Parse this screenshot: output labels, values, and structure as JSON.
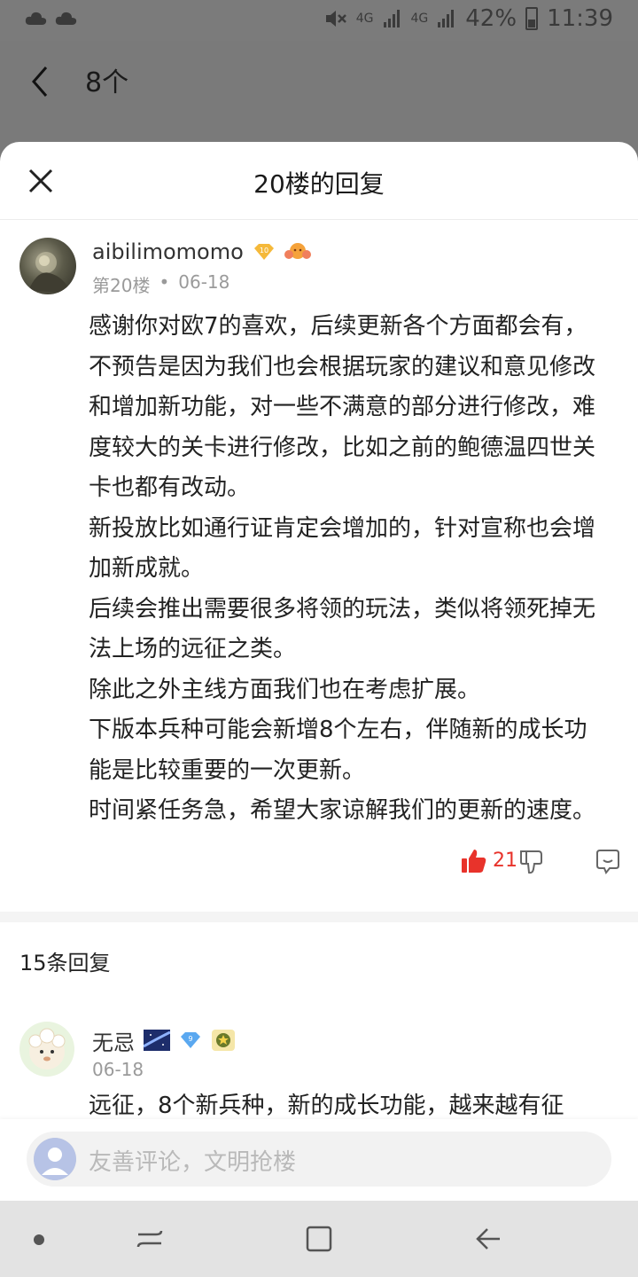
{
  "status_bar": {
    "battery": "42%",
    "time": "11:39",
    "net1": "4G",
    "net2": "4G"
  },
  "page": {
    "count_title": "8个"
  },
  "sheet": {
    "title": "20楼的回复"
  },
  "post": {
    "username": "aibilimomomo",
    "level": "10",
    "floor": "第20楼",
    "separator": "•",
    "date": "06-18",
    "paragraphs": [
      "感谢你对欧7的喜欢，后续更新各个方面都会有，不预告是因为我们也会根据玩家的建议和意见修改和增加新功能，对一些不满意的部分进行修改，难度较大的关卡进行修改，比如之前的鲍德温四世关卡也都有改动。",
      "新投放比如通行证肯定会增加的，针对宣称也会增加新成就。",
      "后续会推出需要很多将领的玩法，类似将领死掉无法上场的远征之类。",
      "除此之外主线方面我们也在考虑扩展。",
      "下版本兵种可能会新增8个左右，伴随新的成长功能是比较重要的一次更新。",
      "时间紧任务急，希望大家谅解我们的更新的速度。"
    ],
    "like_count": "21"
  },
  "replies": {
    "count_label": "15条回复",
    "items": [
      {
        "username": "无忌",
        "level": "9",
        "date": "06-18",
        "preview": "远征，8个新兵种，新的成长功能，越来越有征"
      }
    ]
  },
  "comment": {
    "placeholder": "友善评论，文明抢楼"
  },
  "colors": {
    "accent_red": "#e8332b",
    "gold_badge": "#f5b93a",
    "blue_badge": "#5aa8f0"
  },
  "icons": [
    "cloud-icon",
    "mute-icon",
    "signal-icon",
    "battery-icon",
    "back-icon",
    "close-icon",
    "thumbs-up-icon",
    "thumbs-down-icon",
    "chat-icon",
    "edit-icon",
    "nav-back-icon",
    "nav-home-icon",
    "nav-recents-icon"
  ]
}
